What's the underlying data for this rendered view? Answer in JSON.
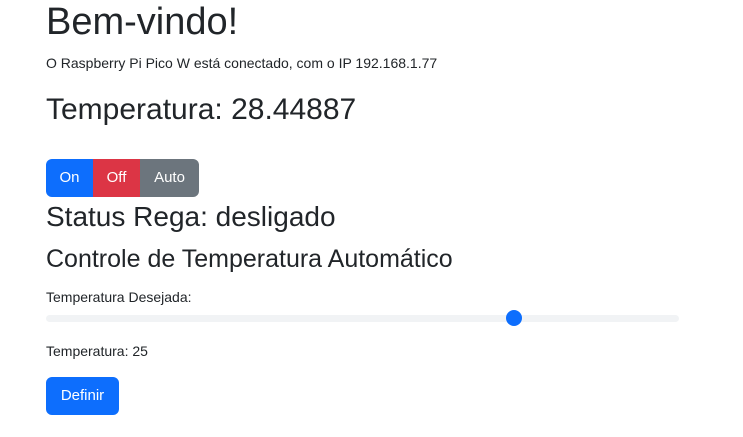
{
  "header": {
    "title": "Bem-vindo!",
    "connection_text": "O Raspberry Pi Pico W está conectado, com o IP 192.168.1.77"
  },
  "temperature": {
    "heading": "Temperatura: 28.44887"
  },
  "mode_buttons": {
    "on_label": "On",
    "off_label": "Off",
    "auto_label": "Auto"
  },
  "status": {
    "heading": "Status Rega: desligado"
  },
  "auto_control": {
    "heading": "Controle de Temperatura Automático",
    "desired_label": "Temperatura Desejada:",
    "slider_fraction": 0.74,
    "current_value_text": "Temperatura: 25",
    "define_label": "Definir"
  },
  "colors": {
    "primary": "#0d6efd",
    "danger": "#dc3545",
    "secondary": "#6c757d",
    "track": "#f1f3f5",
    "text": "#212529"
  }
}
